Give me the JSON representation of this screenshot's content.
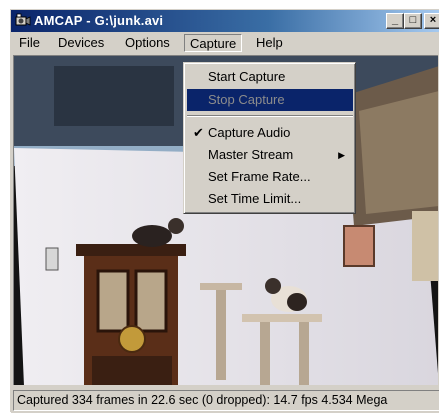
{
  "window": {
    "title": "AMCAP - G:\\junk.avi",
    "minimize_glyph": "_",
    "maximize_glyph": "□",
    "close_glyph": "×"
  },
  "menubar": {
    "items": [
      {
        "label": "File"
      },
      {
        "label": "Devices"
      },
      {
        "label": "Options"
      },
      {
        "label": "Capture"
      },
      {
        "label": "Help"
      }
    ],
    "open_menu": "Capture"
  },
  "capture_menu": {
    "items": [
      {
        "label": "Start Capture",
        "enabled": true
      },
      {
        "label": "Stop Capture",
        "enabled": false,
        "highlighted": true
      },
      {
        "label": "Capture Audio",
        "checked": true
      },
      {
        "label": "Master Stream",
        "submenu": true
      },
      {
        "label": "Set Frame Rate..."
      },
      {
        "label": "Set Time Limit..."
      }
    ],
    "check_glyph": "✔",
    "submenu_glyph": "▶"
  },
  "status": {
    "text": "Captured 334 frames in 22.6 sec (0 dropped): 14.7 fps 4.534 Mega"
  },
  "icons": [
    "app-camera-icon",
    "minimize-icon",
    "maximize-icon",
    "close-icon",
    "checkmark-icon",
    "submenu-arrow-icon"
  ],
  "colors": {
    "title_active": "#0a246a",
    "menu_highlight": "#0a246a",
    "face": "#d4d0c8"
  }
}
